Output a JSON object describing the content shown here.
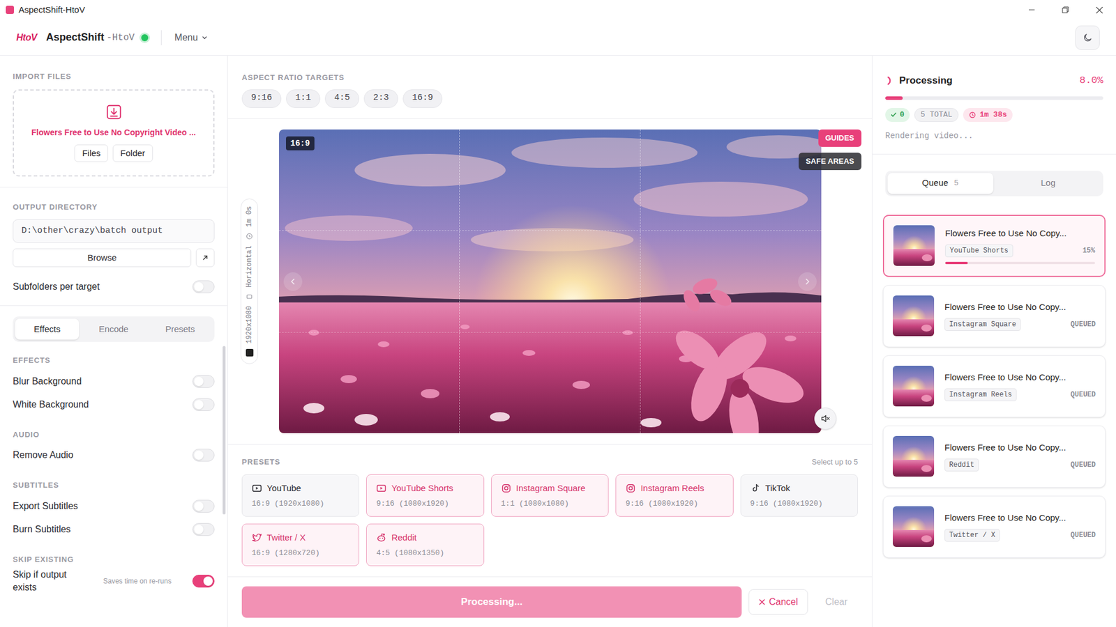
{
  "window": {
    "title": "AspectShift-HtoV"
  },
  "header": {
    "logo": "HtoV",
    "app_name": "AspectShift",
    "app_suffix": "-HtoV",
    "online": true,
    "menu": "Menu"
  },
  "import": {
    "label": "IMPORT FILES",
    "file_name": "Flowers Free to Use No Copyright Video ...",
    "buttons": [
      "Files",
      "Folder"
    ]
  },
  "output": {
    "label": "OUTPUT DIRECTORY",
    "path": "D:\\other\\crazy\\batch output",
    "browse": "Browse"
  },
  "subfolders": {
    "label": "Subfolders per target",
    "on": false
  },
  "settings_tabs": [
    {
      "label": "Effects",
      "selected": true
    },
    {
      "label": "Encode",
      "selected": false
    },
    {
      "label": "Presets",
      "selected": false
    }
  ],
  "sections": [
    {
      "title": "EFFECTS",
      "rows": [
        {
          "label": "Blur Background",
          "on": false
        },
        {
          "label": "White Background",
          "on": false
        }
      ]
    },
    {
      "title": "AUDIO",
      "rows": [
        {
          "label": "Remove Audio",
          "on": false
        }
      ]
    },
    {
      "title": "SUBTITLES",
      "rows": [
        {
          "label": "Export Subtitles",
          "on": false
        },
        {
          "label": "Burn Subtitles",
          "on": false
        }
      ]
    },
    {
      "title": "SKIP EXISTING",
      "rows": [
        {
          "label": "Skip if output exists",
          "hint": "Saves time on re-runs",
          "on": true
        }
      ]
    }
  ],
  "targets": {
    "label": "ASPECT RATIO TARGETS",
    "chips": [
      "9:16",
      "1:1",
      "4:5",
      "2:3",
      "16:9"
    ]
  },
  "preview": {
    "ratio": "16:9",
    "guides": "GUIDES",
    "guides_on": true,
    "safe_areas": "SAFE AREAS",
    "safe_areas_on": false,
    "muted": true,
    "duration": "1m 0s",
    "orientation": "Horizontal",
    "resolution": "1920x1080"
  },
  "presets": {
    "label": "PRESETS",
    "hint": "Select up to 5",
    "items": [
      {
        "name": "YouTube",
        "spec": "16:9 (1920x1080)",
        "selected": false
      },
      {
        "name": "YouTube Shorts",
        "spec": "9:16 (1080x1920)",
        "selected": true
      },
      {
        "name": "Instagram Square",
        "spec": "1:1 (1080x1080)",
        "selected": true
      },
      {
        "name": "Instagram Reels",
        "spec": "9:16 (1080x1920)",
        "selected": true
      },
      {
        "name": "TikTok",
        "spec": "9:16 (1080x1920)",
        "selected": false
      },
      {
        "name": "Twitter / X",
        "spec": "16:9 (1280x720)",
        "selected": true
      },
      {
        "name": "Reddit",
        "spec": "4:5 (1080x1350)",
        "selected": true
      }
    ]
  },
  "actions": {
    "primary": "Processing...",
    "primary_disabled": true,
    "cancel": "Cancel",
    "clear": "Clear",
    "clear_disabled": true
  },
  "progress": {
    "title": "Processing",
    "percent": "8.0%",
    "level": 0.08,
    "done": "0",
    "total": "5 TOTAL",
    "eta": "1m 38s",
    "status": "Rendering video..."
  },
  "queue_tabs": [
    {
      "label": "Queue",
      "count": "5",
      "selected": true
    },
    {
      "label": "Log",
      "selected": false
    }
  ],
  "queue": [
    {
      "title": "Flowers Free to Use No Copy...",
      "tag": "YouTube Shorts",
      "status": "15%",
      "active": true,
      "level": 0.15
    },
    {
      "title": "Flowers Free to Use No Copy...",
      "tag": "Instagram Square",
      "status": "QUEUED",
      "active": false
    },
    {
      "title": "Flowers Free to Use No Copy...",
      "tag": "Instagram Reels",
      "status": "QUEUED",
      "active": false
    },
    {
      "title": "Flowers Free to Use No Copy...",
      "tag": "Reddit",
      "status": "QUEUED",
      "active": false
    },
    {
      "title": "Flowers Free to Use No Copy...",
      "tag": "Twitter / X",
      "status": "QUEUED",
      "active": false
    }
  ]
}
